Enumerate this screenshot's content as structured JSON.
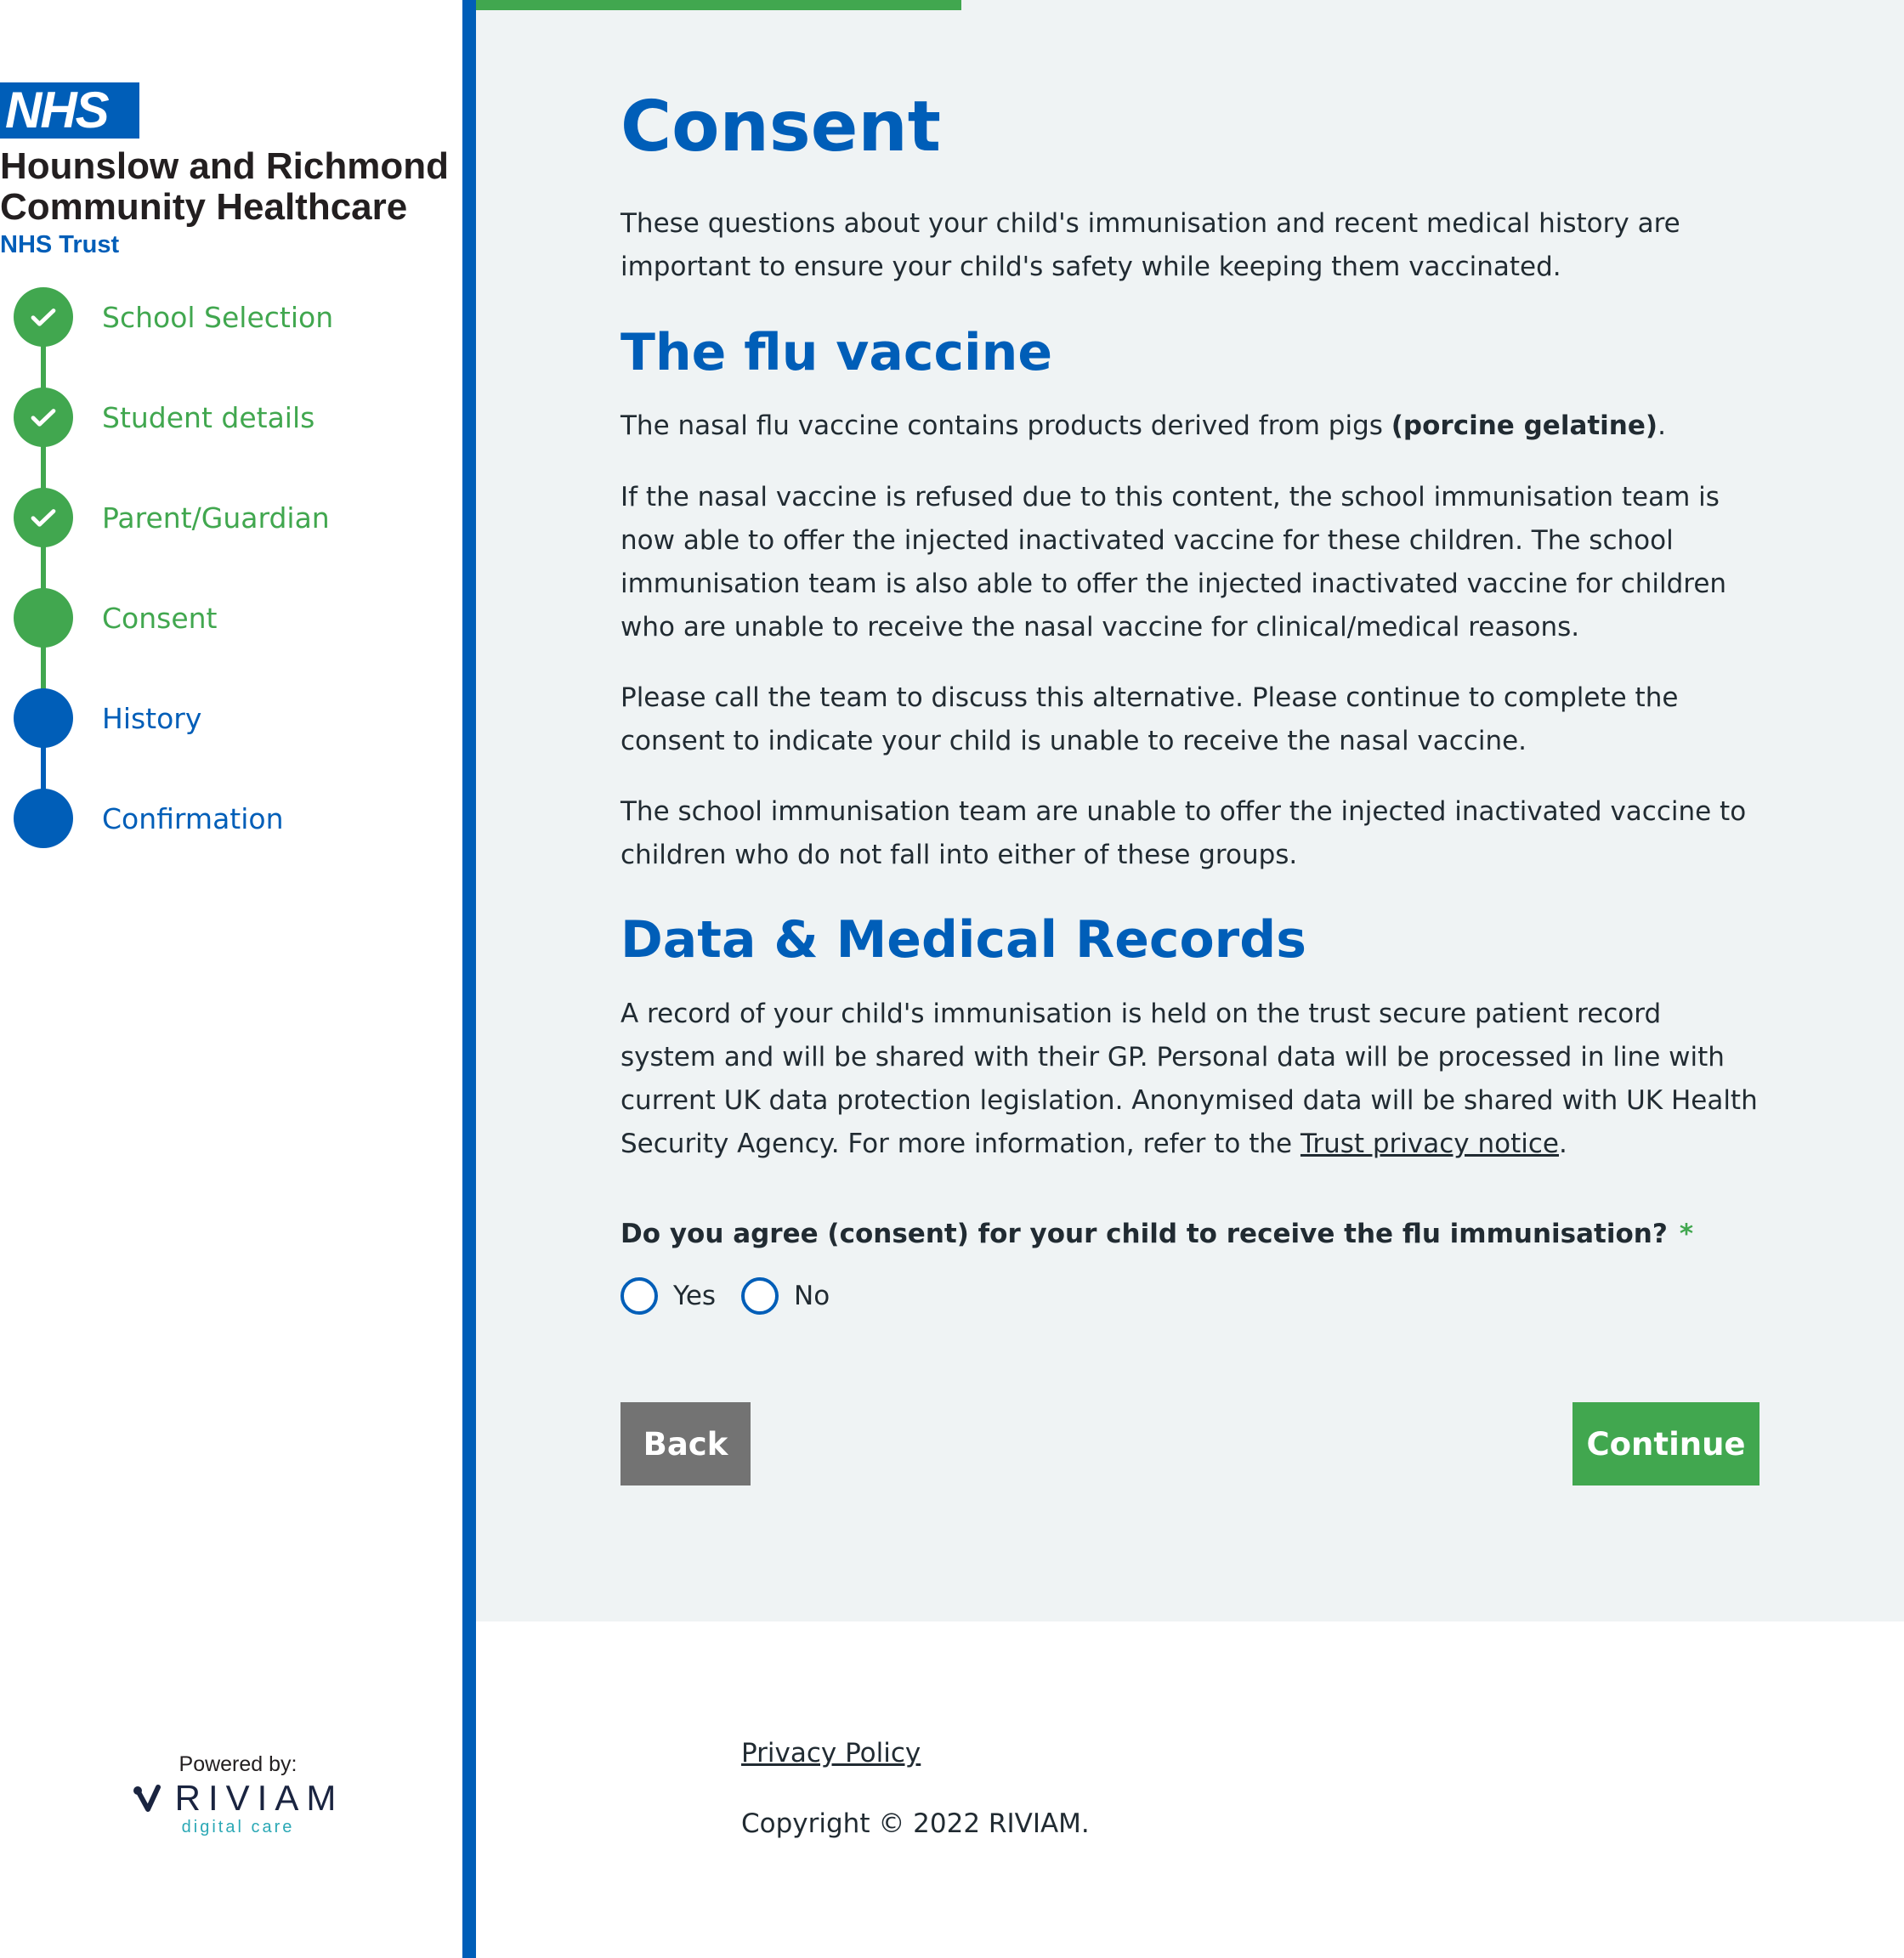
{
  "sidebar": {
    "logo": {
      "badge": "NHS",
      "org_line1": "Hounslow and Richmond",
      "org_line2": "Community Healthcare",
      "org_sub": "NHS Trust"
    },
    "steps": [
      {
        "label": "School Selection",
        "status": "complete"
      },
      {
        "label": "Student details",
        "status": "complete"
      },
      {
        "label": "Parent/Guardian",
        "status": "complete"
      },
      {
        "label": "Consent",
        "status": "current"
      },
      {
        "label": "History",
        "status": "upcoming"
      },
      {
        "label": "Confirmation",
        "status": "upcoming"
      }
    ],
    "powered_by": {
      "label": "Powered by:",
      "brand": "RIVIAM",
      "tagline": "digital care"
    }
  },
  "progress": {
    "fraction": 0.34
  },
  "main": {
    "title": "Consent",
    "intro": "These questions about your child's immunisation and recent medical history are important to ensure your child's safety while keeping them vaccinated.",
    "flu_heading": "The flu vaccine",
    "flu_p1_text": "The nasal flu vaccine contains products derived from pigs",
    "flu_p1_bold": "(porcine gelatine)",
    "flu_p1_end": ".",
    "flu_p2": "If the nasal vaccine is refused due to this content, the school immunisation team is now able to offer the injected inactivated vaccine for these children. The school immunisation team is also able to offer the injected inactivated vaccine for children who are unable to receive the nasal vaccine for clinical/medical reasons.",
    "flu_p3": "Please call the team to discuss this alternative. Please continue to complete the consent to indicate your child is unable to receive the nasal vaccine.",
    "flu_p4": "The school immunisation team are unable to offer the injected inactivated vaccine to children who do not fall into either of these groups.",
    "records_heading": "Data & Medical Records",
    "records_text": "A record of your child's immunisation is held on the trust secure patient record system and will be shared with their GP. Personal data will be processed in line with current UK data protection legislation. Anonymised data will be shared with UK Health Security Agency. For more information, refer to the",
    "records_link": "Trust privacy notice",
    "records_end": ".",
    "question": "Do you agree (consent) for your child to receive the flu immunisation?",
    "required_mark": "*",
    "options": [
      "Yes",
      "No"
    ],
    "back_label": "Back",
    "continue_label": "Continue"
  },
  "footer": {
    "privacy_link": "Privacy Policy",
    "copyright": "Copyright © 2022 RIVIAM."
  },
  "colors": {
    "nhs_blue": "#005eb8",
    "green": "#41a74f",
    "panel_bg": "#eff3f4",
    "back_button": "#737373",
    "text": "#212b32"
  },
  "icons": {
    "step_complete": "check-icon",
    "brand_mark": "riviam-logo-icon"
  }
}
